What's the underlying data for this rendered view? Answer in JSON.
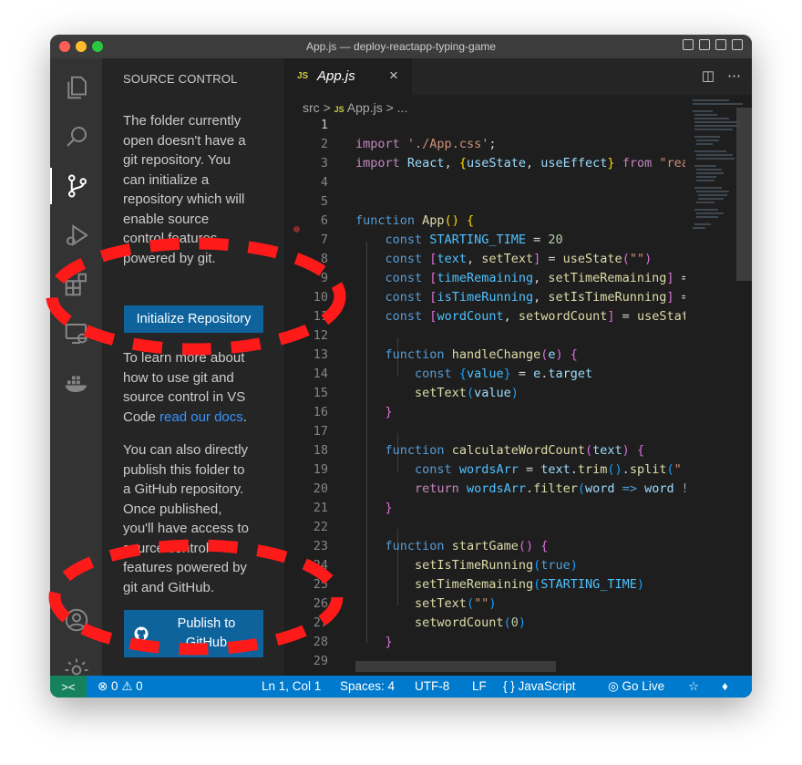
{
  "window": {
    "title": "App.js — deploy-reactapp-typing-game"
  },
  "activity_bar": {
    "icons": [
      "explorer-icon",
      "search-icon",
      "source-control-icon",
      "run-debug-icon",
      "extensions-icon",
      "remote-explorer-icon",
      "docker-icon",
      "account-icon",
      "settings-gear-icon"
    ]
  },
  "sidebar": {
    "title": "SOURCE CONTROL",
    "para1_lines": [
      "The folder currently",
      "open doesn't have a",
      "git repository. You",
      "can initialize a",
      "repository which will",
      "enable source",
      "control features",
      "powered by git."
    ],
    "init_button": "Initialize Repository",
    "para2_lines": [
      "To learn more about",
      "how to use git and",
      "source control in VS"
    ],
    "para2_last_prefix": "Code ",
    "para2_link": "read our docs",
    "para2_last_suffix": ".",
    "para3_lines": [
      "You can also directly",
      "publish this folder to",
      "a GitHub repository.",
      "Once published,",
      "you'll have access to",
      "source control",
      "features powered by",
      "git and GitHub."
    ],
    "publish_button_line1": "Publish to",
    "publish_button_line2": "GitHub"
  },
  "editor": {
    "tab_badge": "JS",
    "tab_name": "App.js",
    "tab_close": "×",
    "breadcrumb_src": "src",
    "breadcrumb_sep": ">",
    "breadcrumb_file": "App.js",
    "breadcrumb_more": "> ...",
    "line_numbers": [
      "1",
      "2",
      "3",
      "4",
      "5",
      "6",
      "7",
      "8",
      "9",
      "10",
      "11",
      "12",
      "13",
      "14",
      "15",
      "16",
      "17",
      "18",
      "19",
      "20",
      "21",
      "22",
      "23",
      "24",
      "25",
      "26",
      "27",
      "28",
      "29"
    ]
  },
  "status_bar": {
    "remote": "><",
    "problems": "⊗ 0 ⚠ 0",
    "cursor": "Ln 1, Col 1",
    "spaces": "Spaces: 4",
    "encoding": "UTF-8",
    "eol": "LF",
    "language": "{ } JavaScript",
    "go_live": "Go Live"
  },
  "colors": {
    "accent": "#007acc",
    "button": "#0e639c",
    "annotation_red": "#ff1a1a"
  }
}
